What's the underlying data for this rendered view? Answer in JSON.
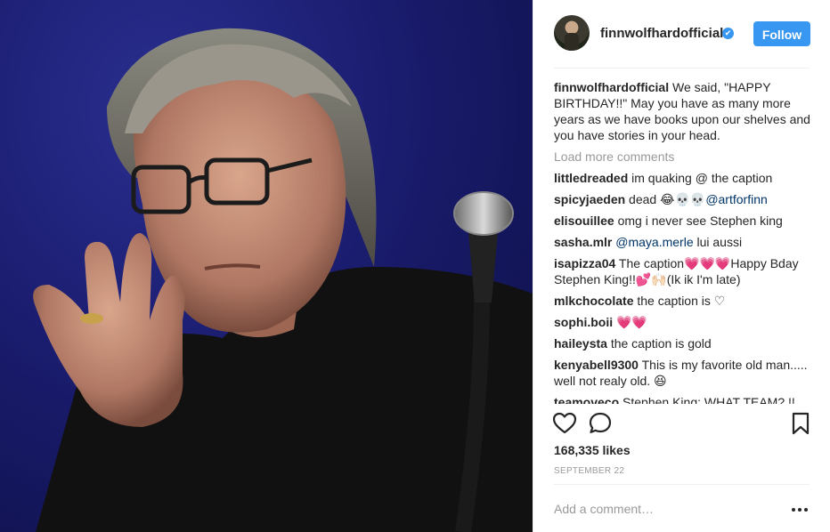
{
  "header": {
    "username": "finnwolfhardofficial",
    "verified_mark": "✔",
    "follow_label": "Follow"
  },
  "caption": {
    "username": "finnwolfhardofficial",
    "text": "We said, \"HAPPY BIRTHDAY!!\" May you have as many more years as we have books upon our shelves and you have stories in your head."
  },
  "load_more_label": "Load more comments",
  "comments": [
    {
      "username": "littledreaded",
      "text": "im quaking @ the caption"
    },
    {
      "username": "spicyjaeden",
      "text": "dead 😂💀💀",
      "mention": "@artforfinn"
    },
    {
      "username": "elisouillee",
      "text": "omg i never see Stephen king"
    },
    {
      "username": "sasha.mlr",
      "mention": "@maya.merle",
      "text": "lui aussi"
    },
    {
      "username": "isapizza04",
      "text": "The caption💗💗💗Happy Bday Stephen King!!💕🙌🏻(Ik ik I'm late)"
    },
    {
      "username": "mlkchocolate",
      "text": "the caption is ♡"
    },
    {
      "username": "sophi.boii",
      "text": "💗💗"
    },
    {
      "username": "haileysta",
      "text": "the caption is gold"
    },
    {
      "username": "kenyabell9300",
      "text": "This is my favorite old man..... well not realy old. 😆"
    },
    {
      "username": "teamoveco",
      "text": "Stephen King: WHAT TEAM? !!"
    }
  ],
  "likes": "168,335 likes",
  "date": "SEPTEMBER 22",
  "add_comment_placeholder": "Add a comment…",
  "icons": {
    "like": "heart-icon",
    "comment": "comment-icon",
    "save": "bookmark-icon",
    "more": "more-options-icon"
  },
  "colors": {
    "accent": "#3897f0",
    "muted": "#999999",
    "mention": "#003569"
  }
}
